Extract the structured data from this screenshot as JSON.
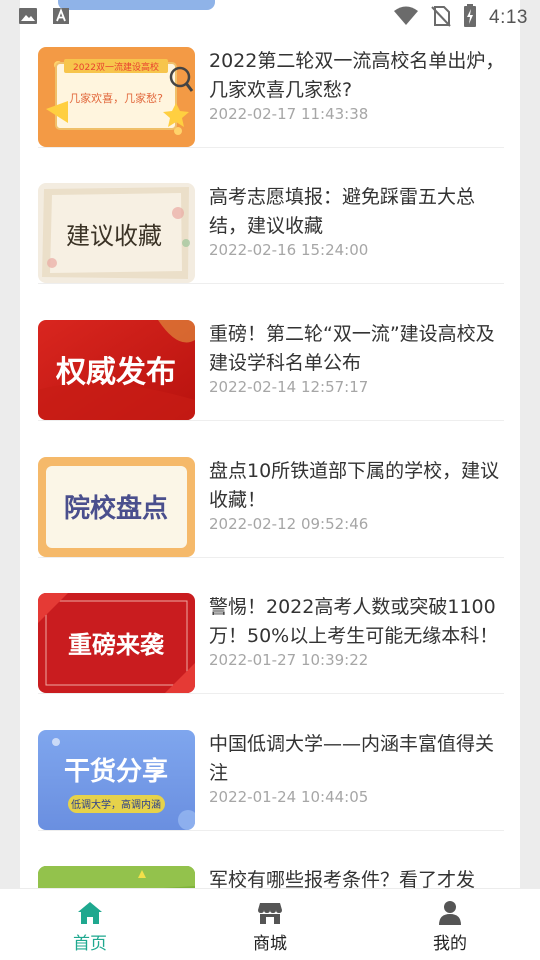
{
  "status_bar": {
    "time": "4:13",
    "left_icons": [
      "image-icon",
      "font-a-icon"
    ],
    "right_icons": [
      "wifi-icon",
      "no-sim-icon",
      "battery-charging-icon"
    ]
  },
  "articles": [
    {
      "title": "2022第二轮双一流高校名单出炉，几家欢喜几家愁?",
      "date": "2022-02-17 11:43:38",
      "thumb": {
        "line1": "2022双一流建设高校",
        "line2": "几家欢喜，几家愁?"
      }
    },
    {
      "title": "高考志愿填报：避免踩雷五大总结，建议收藏",
      "date": "2022-02-16 15:24:00",
      "thumb": {
        "line1": "建议收藏"
      }
    },
    {
      "title": "重磅！第二轮“双一流”建设高校及建设学科名单公布",
      "date": "2022-02-14 12:57:17",
      "thumb": {
        "line1": "权威发布"
      }
    },
    {
      "title": "盘点10所铁道部下属的学校，建议收藏！",
      "date": "2022-02-12 09:52:46",
      "thumb": {
        "line1": "院校盘点"
      }
    },
    {
      "title": "警惕！2022高考人数或突破1100万！50%以上考生可能无缘本科！",
      "date": "2022-01-27 10:39:22",
      "thumb": {
        "line1": "重磅来袭"
      }
    },
    {
      "title": "中国低调大学——内涵丰富值得关注",
      "date": "2022-01-24 10:44:05",
      "thumb": {
        "line1": "干货分享",
        "line2": "低调大学，高调内涵"
      }
    },
    {
      "title": "军校有哪些报考条件？看了才发",
      "date": "",
      "thumb": {}
    }
  ],
  "bottom_nav": [
    {
      "label": "首页",
      "icon": "home-icon",
      "active": true
    },
    {
      "label": "商城",
      "icon": "store-icon",
      "active": false
    },
    {
      "label": "我的",
      "icon": "user-icon",
      "active": false
    }
  ],
  "colors": {
    "accent": "#1fa88f",
    "title_text": "#333333",
    "date_text": "#a6a6a6",
    "background": "#ececec"
  }
}
